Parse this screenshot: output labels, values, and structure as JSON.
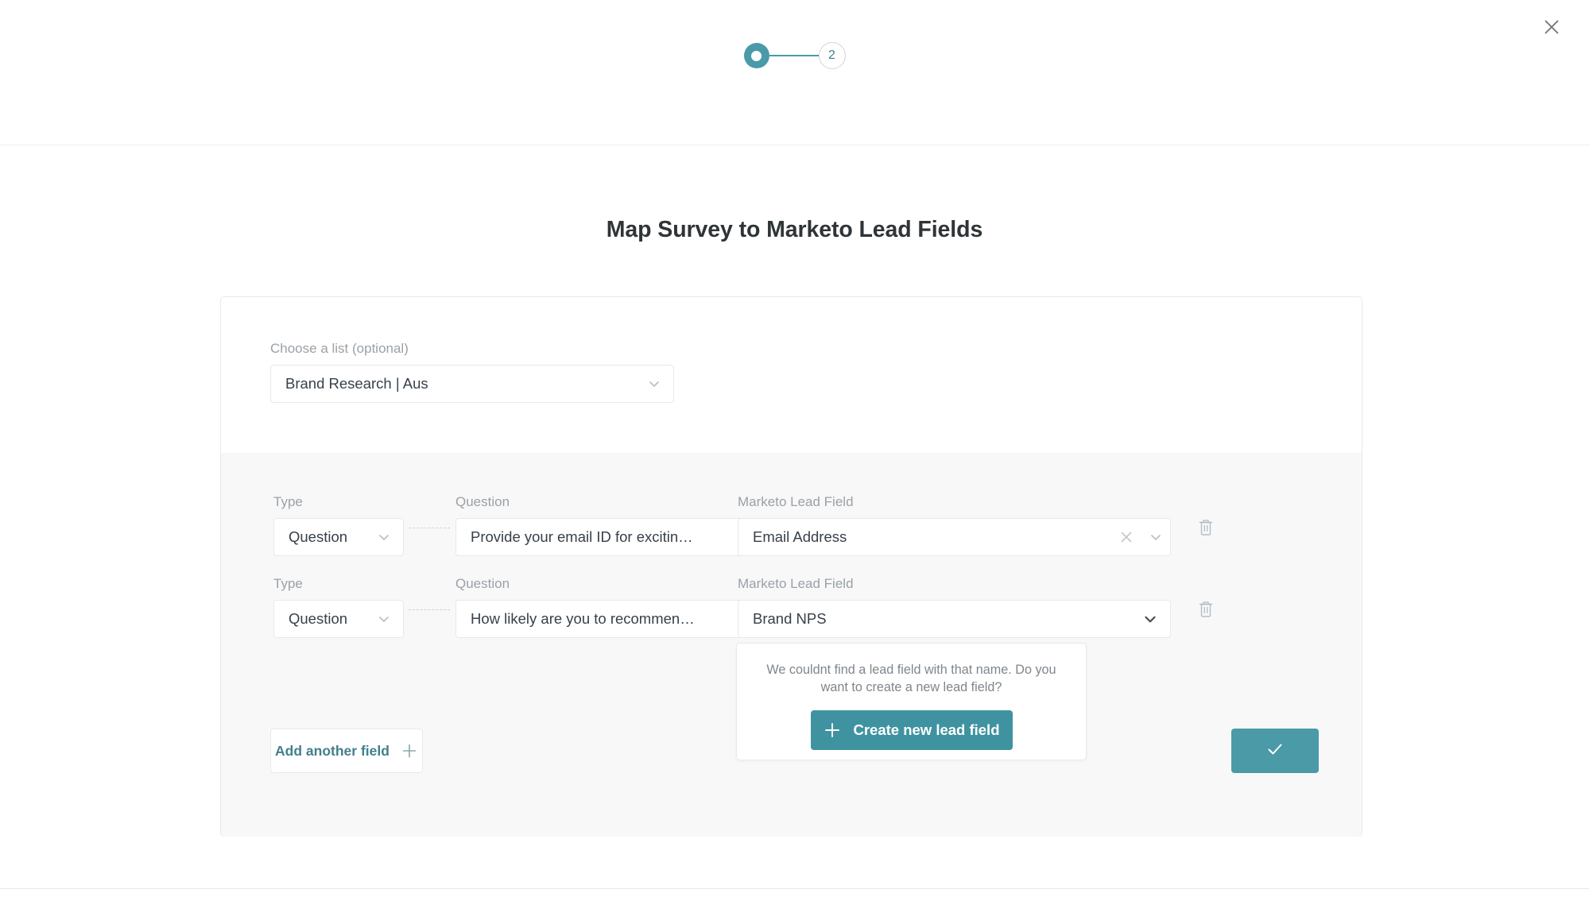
{
  "header": {
    "close_icon": "close-icon",
    "stepper": {
      "step1_state": "completed",
      "step2_label": "2",
      "accent": "#4a9aa7"
    }
  },
  "page_title": "Map Survey to Marketo Lead Fields",
  "card": {
    "list_selector": {
      "label": "Choose a list (optional)",
      "value": "Brand Research | Aus",
      "chevron_icon": "chevron-down-icon"
    },
    "column_labels": {
      "type": "Type",
      "question": "Question",
      "lead_field": "Marketo Lead Field"
    },
    "rows": [
      {
        "type_value": "Question",
        "question_value": "Provide your email ID for excitin…",
        "lead_field_value": "Email Address",
        "has_clear": true,
        "delete_icon": "trash-icon"
      },
      {
        "type_value": "Question",
        "question_value": "How likely are you to recommen…",
        "lead_field_value": "Brand NPS",
        "has_clear": false,
        "delete_icon": "trash-icon"
      }
    ],
    "add_field_label": "Add another field",
    "add_field_icon": "plus-icon",
    "submit_icon": "check-icon",
    "submit_color": "#4a9aa7"
  },
  "popover": {
    "message": "We couldnt find a lead field with that name. Do you want to create a new lead field?",
    "button_label": "Create new lead field",
    "button_icon": "plus-icon",
    "button_color": "#3f93a1"
  }
}
